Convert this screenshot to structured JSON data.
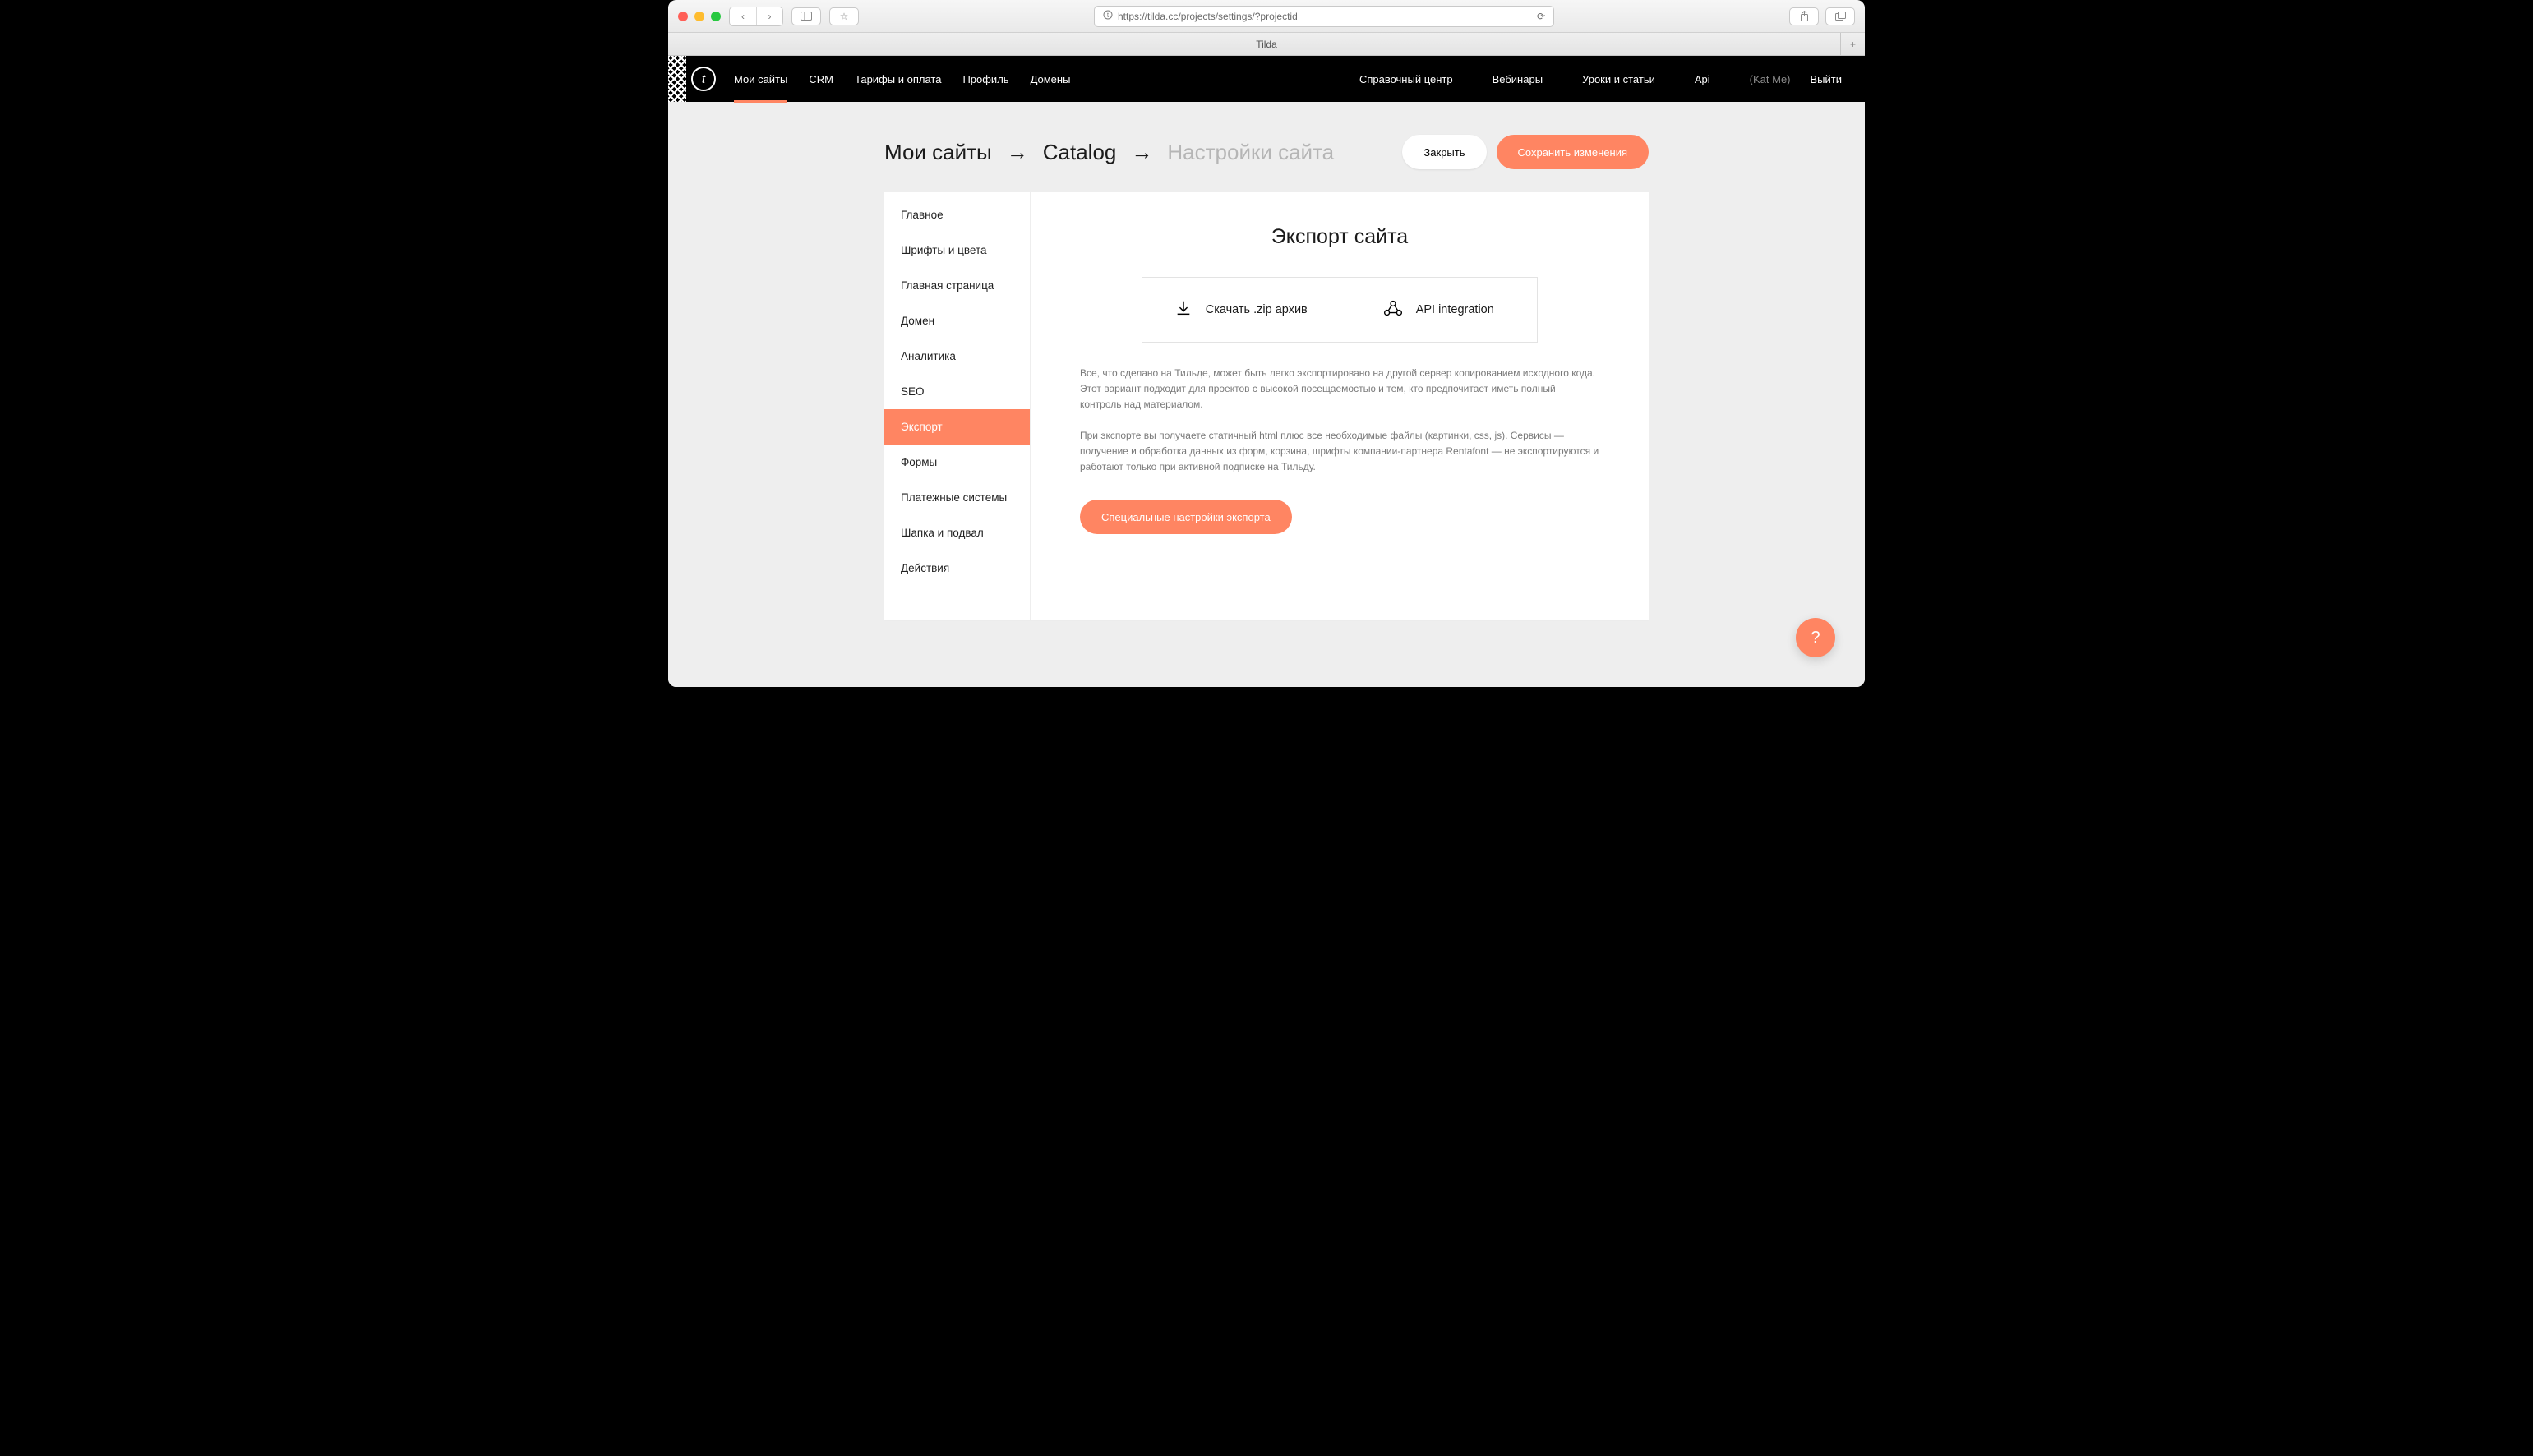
{
  "browser": {
    "url": "https://tilda.cc/projects/settings/?projectid",
    "tab_title": "Tilda"
  },
  "topnav": {
    "logo_glyph": "t",
    "left": [
      "Мои сайты",
      "CRM",
      "Тарифы и оплата",
      "Профиль",
      "Домены"
    ],
    "left_active_index": 0,
    "right": [
      "Справочный центр",
      "Вебинары",
      "Уроки и статьи",
      "Api"
    ],
    "user": "(Kat Me)",
    "logout": "Выйти"
  },
  "breadcrumb": {
    "items": [
      "Мои сайты",
      "Catalog",
      "Настройки сайта"
    ],
    "arrow": "→"
  },
  "actions": {
    "close": "Закрыть",
    "save": "Сохранить изменения"
  },
  "sidebar": {
    "items": [
      "Главное",
      "Шрифты и цвета",
      "Главная страница",
      "Домен",
      "Аналитика",
      "SEO",
      "Экспорт",
      "Формы",
      "Платежные системы",
      "Шапка и подвал",
      "Действия"
    ],
    "active_index": 6
  },
  "content": {
    "title": "Экспорт сайта",
    "option_zip": "Скачать .zip архив",
    "option_api": "API integration",
    "desc1": "Все, что сделано на Тильде, может быть легко экспортировано на другой сервер копированием исходного кода. Этот вариант подходит для проектов с высокой посещаемостью и тем, кто предпочитает иметь полный контроль над материалом.",
    "desc2": "При экспорте вы получаете статичный html плюс все необходимые файлы (картинки, css, js). Сервисы — получение и обработка данных из форм, корзина, шрифты компании-партнера Rentafont — не экспортируются и работают только при активной подписке на Тильду.",
    "cta": "Специальные настройки экспорта"
  },
  "help_glyph": "?"
}
